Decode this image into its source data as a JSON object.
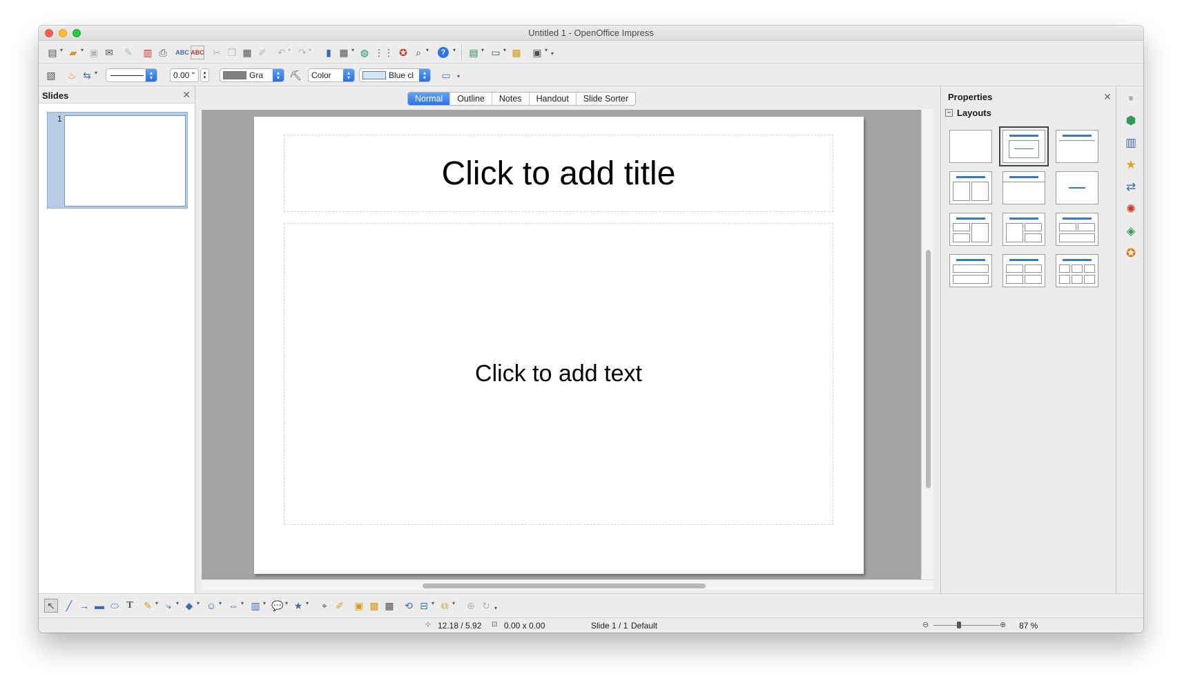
{
  "window": {
    "title": "Untitled 1 - OpenOffice Impress"
  },
  "toolbar_standard": {
    "icons": [
      "new-icon",
      "open-icon",
      "save-icon",
      "email-icon",
      "edit-file-icon",
      "export-pdf-icon",
      "print-icon",
      "spellcheck-icon",
      "autospell-icon",
      "cut-icon",
      "copy-icon",
      "paste-icon",
      "clone-format-icon",
      "undo-icon",
      "redo-icon",
      "chart-icon",
      "table-icon",
      "hyperlink-icon",
      "grid-icon",
      "navigator-icon",
      "zoom-icon",
      "help-icon",
      "slide-icon",
      "slide-layout-icon",
      "slide-design-icon",
      "slideshow-icon"
    ]
  },
  "toolbar_line_fill": {
    "line_width": "0.00 \"",
    "area_style": "Gra",
    "fill_type": "Color",
    "fill_color": "Blue cl",
    "swatch_gray": "#808080",
    "swatch_blue": "#cfe6fb"
  },
  "slides_pane": {
    "title": "Slides",
    "close": "✕",
    "slides": [
      {
        "number": "1"
      }
    ]
  },
  "view_tabs": [
    "Normal",
    "Outline",
    "Notes",
    "Handout",
    "Slide Sorter"
  ],
  "slide": {
    "title_placeholder": "Click to add title",
    "body_placeholder": "Click to add text"
  },
  "properties": {
    "title": "Properties",
    "close": "✕",
    "section": "Layouts",
    "collapse": "−"
  },
  "drawing_toolbar": {
    "icons": [
      "select-icon",
      "line-icon",
      "arrow-line-icon",
      "rectangle-icon",
      "ellipse-icon",
      "text-icon",
      "curve-icon",
      "connector-icon",
      "basic-shapes-icon",
      "symbol-shapes-icon",
      "block-arrows-icon",
      "flowchart-icon",
      "callouts-icon",
      "stars-icon",
      "points-icon",
      "glue-points-icon",
      "fontwork-icon",
      "from-file-icon",
      "gallery-icon",
      "rotate-icon",
      "align-icon",
      "arrange-icon",
      "extrusion-icon",
      "toggle-3d-icon"
    ]
  },
  "status": {
    "position": "12.18 / 5.92",
    "size": "0.00 x 0.00",
    "slide": "Slide 1 / 1",
    "master": "Default",
    "zoom": "87 %"
  },
  "colors": {
    "accent": "#2f73e6",
    "canvas": "#a4a4a4",
    "layout_bar": "#3a77c2"
  }
}
